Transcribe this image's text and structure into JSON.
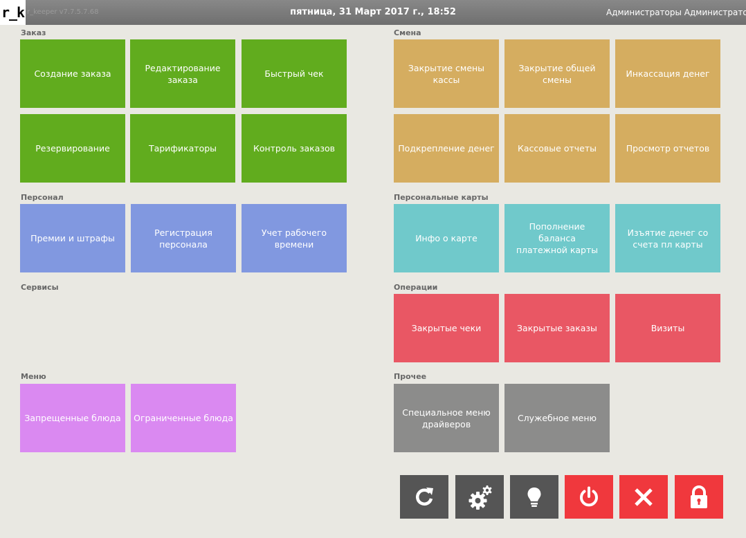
{
  "header": {
    "logo": "r_k",
    "version": "r_keeper v7.7.5.7.68",
    "datetime": "пятница, 31 Март 2017 г., 18:52",
    "user": "Администраторы Администратор"
  },
  "sections": {
    "order": {
      "label": "Заказ",
      "items": [
        "Создание заказа",
        "Редактирование заказа",
        "Быстрый чек",
        "Резервирование",
        "Тарификаторы",
        "Контроль заказов"
      ]
    },
    "shift": {
      "label": "Смена",
      "items": [
        "Закрытие смены кассы",
        "Закрытие общей смены",
        "Инкассация денег",
        "Подкрепление денег",
        "Кассовые отчеты",
        "Просмотр отчетов"
      ]
    },
    "staff": {
      "label": "Персонал",
      "items": [
        "Премии и штрафы",
        "Регистрация персонала",
        "Учет рабочего времени"
      ]
    },
    "cards": {
      "label": "Персональные карты",
      "items": [
        "Инфо о карте",
        "Пополнение баланса платежной карты",
        "Изъятие денег со счета пл карты"
      ]
    },
    "services": {
      "label": "Сервисы",
      "items": []
    },
    "operations": {
      "label": "Операции",
      "items": [
        "Закрытые чеки",
        "Закрытые заказы",
        "Визиты"
      ]
    },
    "menu": {
      "label": "Меню",
      "items": [
        "Запрещенные блюда",
        "Ограниченные блюда"
      ]
    },
    "other": {
      "label": "Прочее",
      "items": [
        "Специальное меню драйверов",
        "Служебное меню"
      ]
    }
  },
  "toolbar": [
    {
      "icon": "refresh-icon"
    },
    {
      "icon": "settings-gears-icon"
    },
    {
      "icon": "lightbulb-icon"
    },
    {
      "icon": "power-icon"
    },
    {
      "icon": "close-icon"
    },
    {
      "icon": "lock-icon"
    }
  ],
  "colors": {
    "order": "#61ac1e",
    "shift": "#d5ad60",
    "staff": "#8198e0",
    "cards": "#70c9cb",
    "operations": "#e95764",
    "menu": "#da89f1",
    "other": "#8c8c8b",
    "toolbar_dark": "#555555",
    "toolbar_hot": "#f0383d"
  }
}
